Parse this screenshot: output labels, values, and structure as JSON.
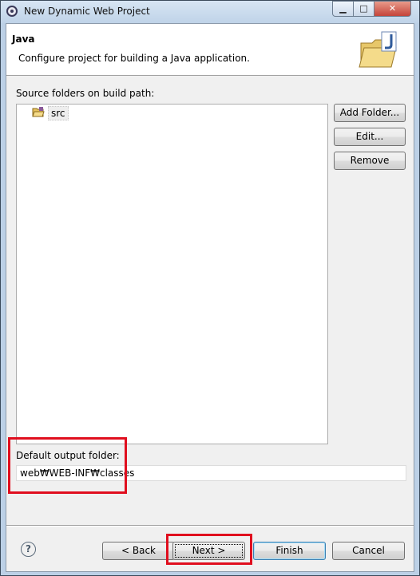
{
  "window": {
    "title": "New Dynamic Web Project"
  },
  "header": {
    "title": "Java",
    "description": "Configure project for building a Java application."
  },
  "source": {
    "label": "Source folders on build path:",
    "items": [
      {
        "label": "src"
      }
    ]
  },
  "side_buttons": {
    "add_folder": "Add Folder...",
    "edit": "Edit...",
    "remove": "Remove"
  },
  "output": {
    "label": "Default output folder:",
    "value": "web₩WEB-INF₩classes"
  },
  "footer": {
    "help": "?",
    "back": "< Back",
    "next": "Next >",
    "finish": "Finish",
    "cancel": "Cancel"
  },
  "window_controls": {
    "minimize": "▁",
    "maximize": "□",
    "close": "✕"
  },
  "colors": {
    "highlight": "#e00e1e",
    "finish_border": "#3c7fb1"
  }
}
